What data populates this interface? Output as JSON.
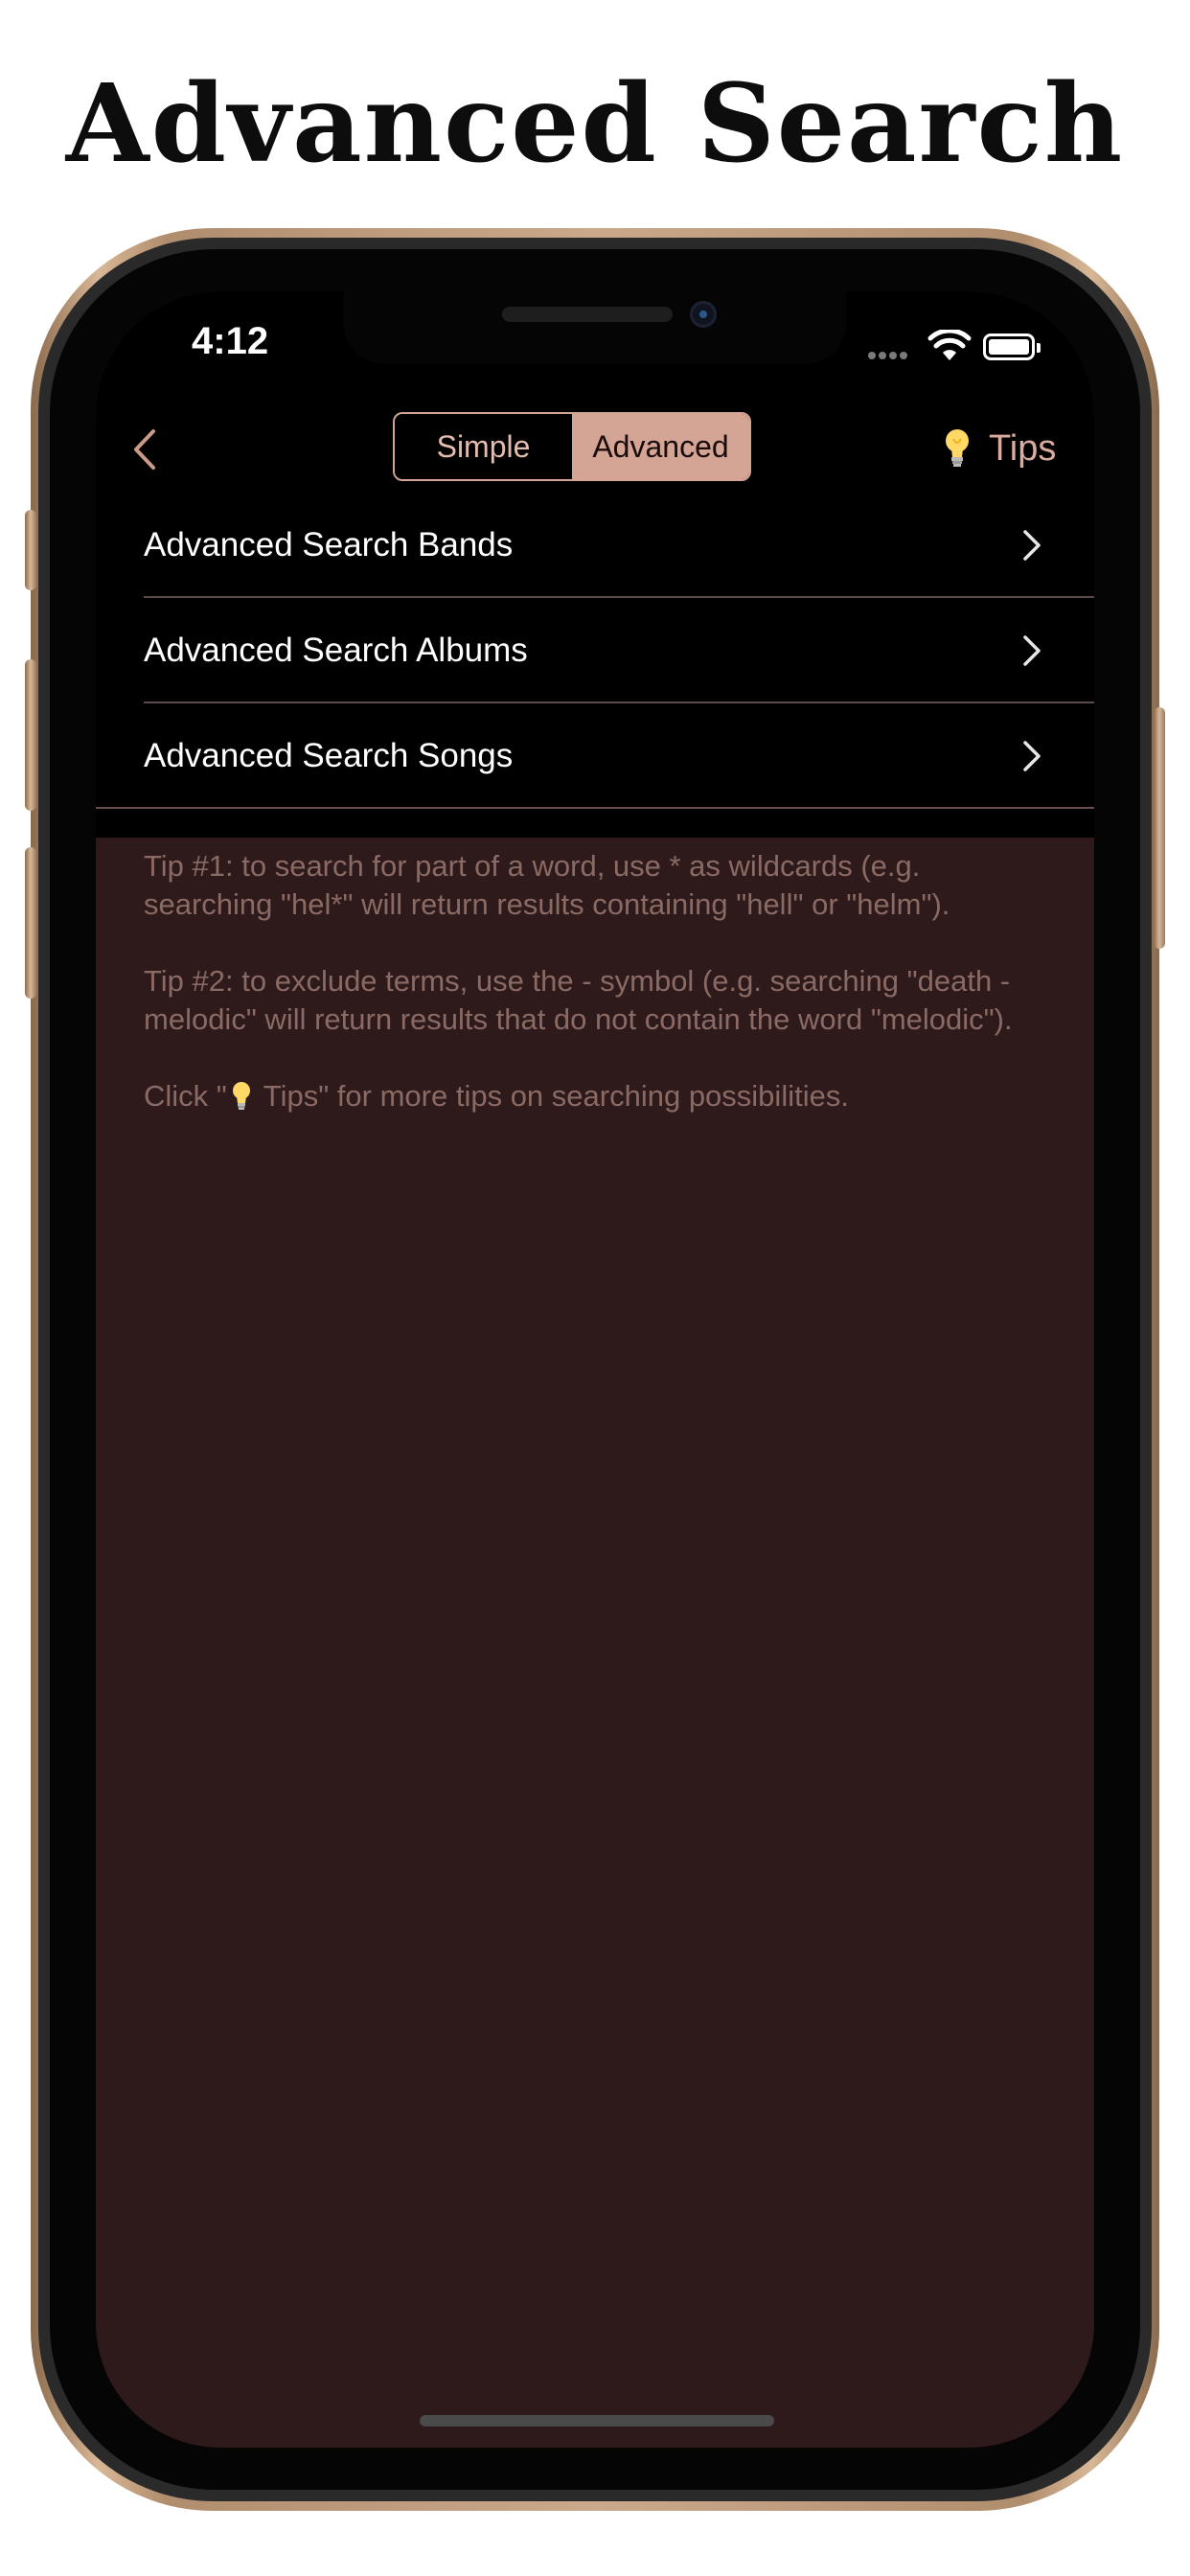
{
  "headline": "Advanced Search",
  "status_bar": {
    "time": "4:12"
  },
  "nav": {
    "segments": [
      {
        "label": "Simple",
        "selected": false
      },
      {
        "label": "Advanced",
        "selected": true
      }
    ],
    "tips_label": "Tips"
  },
  "rows": [
    {
      "label": "Advanced Search Bands"
    },
    {
      "label": "Advanced Search Albums"
    },
    {
      "label": "Advanced Search Songs"
    }
  ],
  "tips": {
    "tip1": "Tip #1: to search for part of a word, use * as wildcards (e.g. searching \"hel*\" will return results containing \"hell\" or \"helm\").",
    "tip2": "Tip #2: to exclude terms, use the - symbol (e.g. searching \"death -melodic\" will return results that do not contain the word \"melodic\").",
    "tip3_prefix": "Click \"",
    "tip3_suffix": "Tips\" for more tips on searching possibilities."
  },
  "colors": {
    "accent": "#d4a594",
    "background": "#2e1a1a",
    "nav_background": "#000000",
    "tip_text": "#8a6a64"
  },
  "icons": [
    "back-chevron-icon",
    "lightbulb-icon",
    "chevron-right-icon",
    "wifi-icon",
    "battery-icon",
    "cellular-icon"
  ]
}
